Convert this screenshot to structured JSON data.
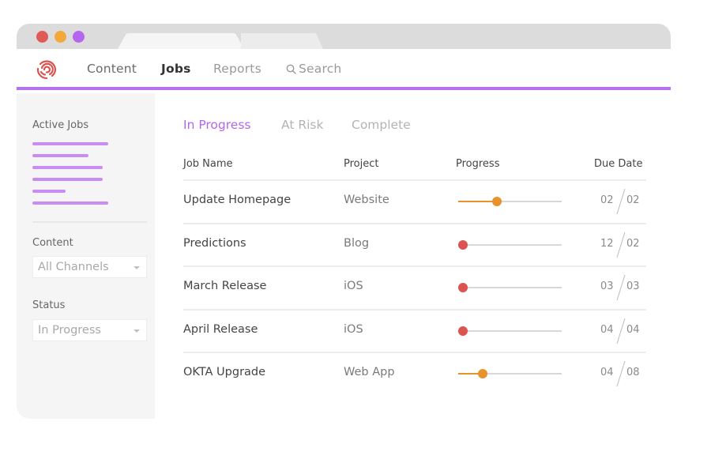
{
  "window": {
    "traffic_lights": [
      "close",
      "minimize",
      "zoom"
    ],
    "colors": {
      "close": "#e05a57",
      "minimize": "#f4a83c",
      "zoom": "#b466ec"
    }
  },
  "nav": {
    "logo": "fingerprint-logo",
    "items": [
      {
        "label": "Content",
        "active": false
      },
      {
        "label": "Jobs",
        "active": true
      },
      {
        "label": "Reports",
        "active": false
      }
    ],
    "search_label": "Search",
    "accent_color": "#b670f0"
  },
  "sidebar": {
    "active_jobs_heading": "Active Jobs",
    "content_heading": "Content",
    "content_select_value": "All Channels",
    "status_heading": "Status",
    "status_select_value": "In Progress"
  },
  "main": {
    "tabs": [
      {
        "label": "In Progress",
        "active": true
      },
      {
        "label": "At Risk",
        "active": false
      },
      {
        "label": "Complete",
        "active": false
      }
    ],
    "columns": [
      "Job Name",
      "Project",
      "Progress",
      "Due Date"
    ],
    "rows": [
      {
        "job": "Update Homepage",
        "project": "Website",
        "progress": 0.33,
        "status_color": "#e8922e",
        "due_left": "02",
        "due_right": "02"
      },
      {
        "job": "Predictions",
        "project": "Blog",
        "progress": 0.0,
        "status_color": "#dc5451",
        "due_left": "12",
        "due_right": "02"
      },
      {
        "job": "March Release",
        "project": "iOS",
        "progress": 0.0,
        "status_color": "#dc5451",
        "due_left": "03",
        "due_right": "03"
      },
      {
        "job": "April Release",
        "project": "iOS",
        "progress": 0.0,
        "status_color": "#dc5451",
        "due_left": "04",
        "due_right": "04"
      },
      {
        "job": "OKTA Upgrade",
        "project": "Web App",
        "progress": 0.19,
        "status_color": "#e8922e",
        "due_left": "04",
        "due_right": "08"
      }
    ]
  }
}
